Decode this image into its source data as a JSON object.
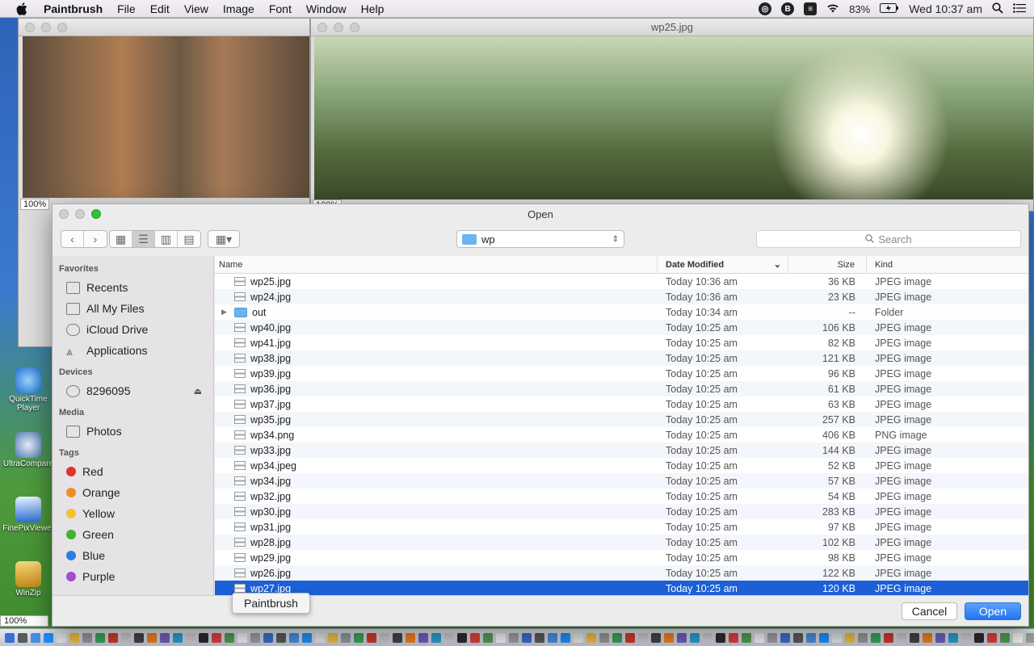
{
  "menubar": {
    "app_name": "Paintbrush",
    "menus": [
      "File",
      "Edit",
      "View",
      "Image",
      "Font",
      "Window",
      "Help"
    ],
    "battery": "83%",
    "clock": "Wed 10:37 am"
  },
  "background_windows": {
    "left_zoom": "100%",
    "right_title": "wp25.jpg",
    "right_zoom": "100%"
  },
  "desktop_icons": [
    "QuickTime Player",
    "UltraCompare",
    "FinePixViewer",
    "WinZip"
  ],
  "dialog": {
    "title": "Open",
    "path_popup": "wp",
    "search_placeholder": "Search",
    "sidebar": {
      "favorites_heading": "Favorites",
      "favorites": [
        "Recents",
        "All My Files",
        "iCloud Drive",
        "Applications"
      ],
      "devices_heading": "Devices",
      "devices": [
        "8296095"
      ],
      "media_heading": "Media",
      "media": [
        "Photos"
      ],
      "tags_heading": "Tags",
      "tags": [
        {
          "label": "Red",
          "color": "#e0322e"
        },
        {
          "label": "Orange",
          "color": "#f28c28"
        },
        {
          "label": "Yellow",
          "color": "#f0c330"
        },
        {
          "label": "Green",
          "color": "#43b32b"
        },
        {
          "label": "Blue",
          "color": "#2f7de1"
        },
        {
          "label": "Purple",
          "color": "#a64bc9"
        }
      ]
    },
    "columns": {
      "name": "Name",
      "date": "Date Modified",
      "size": "Size",
      "kind": "Kind"
    },
    "files": [
      {
        "name": "wp25.jpg",
        "date": "Today 10:36 am",
        "size": "36 KB",
        "kind": "JPEG image"
      },
      {
        "name": "wp24.jpg",
        "date": "Today 10:36 am",
        "size": "23 KB",
        "kind": "JPEG image"
      },
      {
        "name": "out",
        "date": "Today 10:34 am",
        "size": "--",
        "kind": "Folder",
        "folder": true
      },
      {
        "name": "wp40.jpg",
        "date": "Today 10:25 am",
        "size": "106 KB",
        "kind": "JPEG image"
      },
      {
        "name": "wp41.jpg",
        "date": "Today 10:25 am",
        "size": "82 KB",
        "kind": "JPEG image"
      },
      {
        "name": "wp38.jpg",
        "date": "Today 10:25 am",
        "size": "121 KB",
        "kind": "JPEG image"
      },
      {
        "name": "wp39.jpg",
        "date": "Today 10:25 am",
        "size": "96 KB",
        "kind": "JPEG image"
      },
      {
        "name": "wp36.jpg",
        "date": "Today 10:25 am",
        "size": "61 KB",
        "kind": "JPEG image"
      },
      {
        "name": "wp37.jpg",
        "date": "Today 10:25 am",
        "size": "63 KB",
        "kind": "JPEG image"
      },
      {
        "name": "wp35.jpg",
        "date": "Today 10:25 am",
        "size": "257 KB",
        "kind": "JPEG image"
      },
      {
        "name": "wp34.png",
        "date": "Today 10:25 am",
        "size": "406 KB",
        "kind": "PNG image"
      },
      {
        "name": "wp33.jpg",
        "date": "Today 10:25 am",
        "size": "144 KB",
        "kind": "JPEG image"
      },
      {
        "name": "wp34.jpeg",
        "date": "Today 10:25 am",
        "size": "52 KB",
        "kind": "JPEG image"
      },
      {
        "name": "wp34.jpg",
        "date": "Today 10:25 am",
        "size": "57 KB",
        "kind": "JPEG image"
      },
      {
        "name": "wp32.jpg",
        "date": "Today 10:25 am",
        "size": "54 KB",
        "kind": "JPEG image"
      },
      {
        "name": "wp30.jpg",
        "date": "Today 10:25 am",
        "size": "283 KB",
        "kind": "JPEG image"
      },
      {
        "name": "wp31.jpg",
        "date": "Today 10:25 am",
        "size": "97 KB",
        "kind": "JPEG image"
      },
      {
        "name": "wp28.jpg",
        "date": "Today 10:25 am",
        "size": "102 KB",
        "kind": "JPEG image"
      },
      {
        "name": "wp29.jpg",
        "date": "Today 10:25 am",
        "size": "98 KB",
        "kind": "JPEG image"
      },
      {
        "name": "wp26.jpg",
        "date": "Today 10:25 am",
        "size": "122 KB",
        "kind": "JPEG image"
      },
      {
        "name": "wp27.jpg",
        "date": "Today 10:25 am",
        "size": "120 KB",
        "kind": "JPEG image",
        "selected": true
      }
    ],
    "cancel_label": "Cancel",
    "open_label": "Open"
  },
  "tooltip": "Paintbrush",
  "bottom_zoom": "100%"
}
